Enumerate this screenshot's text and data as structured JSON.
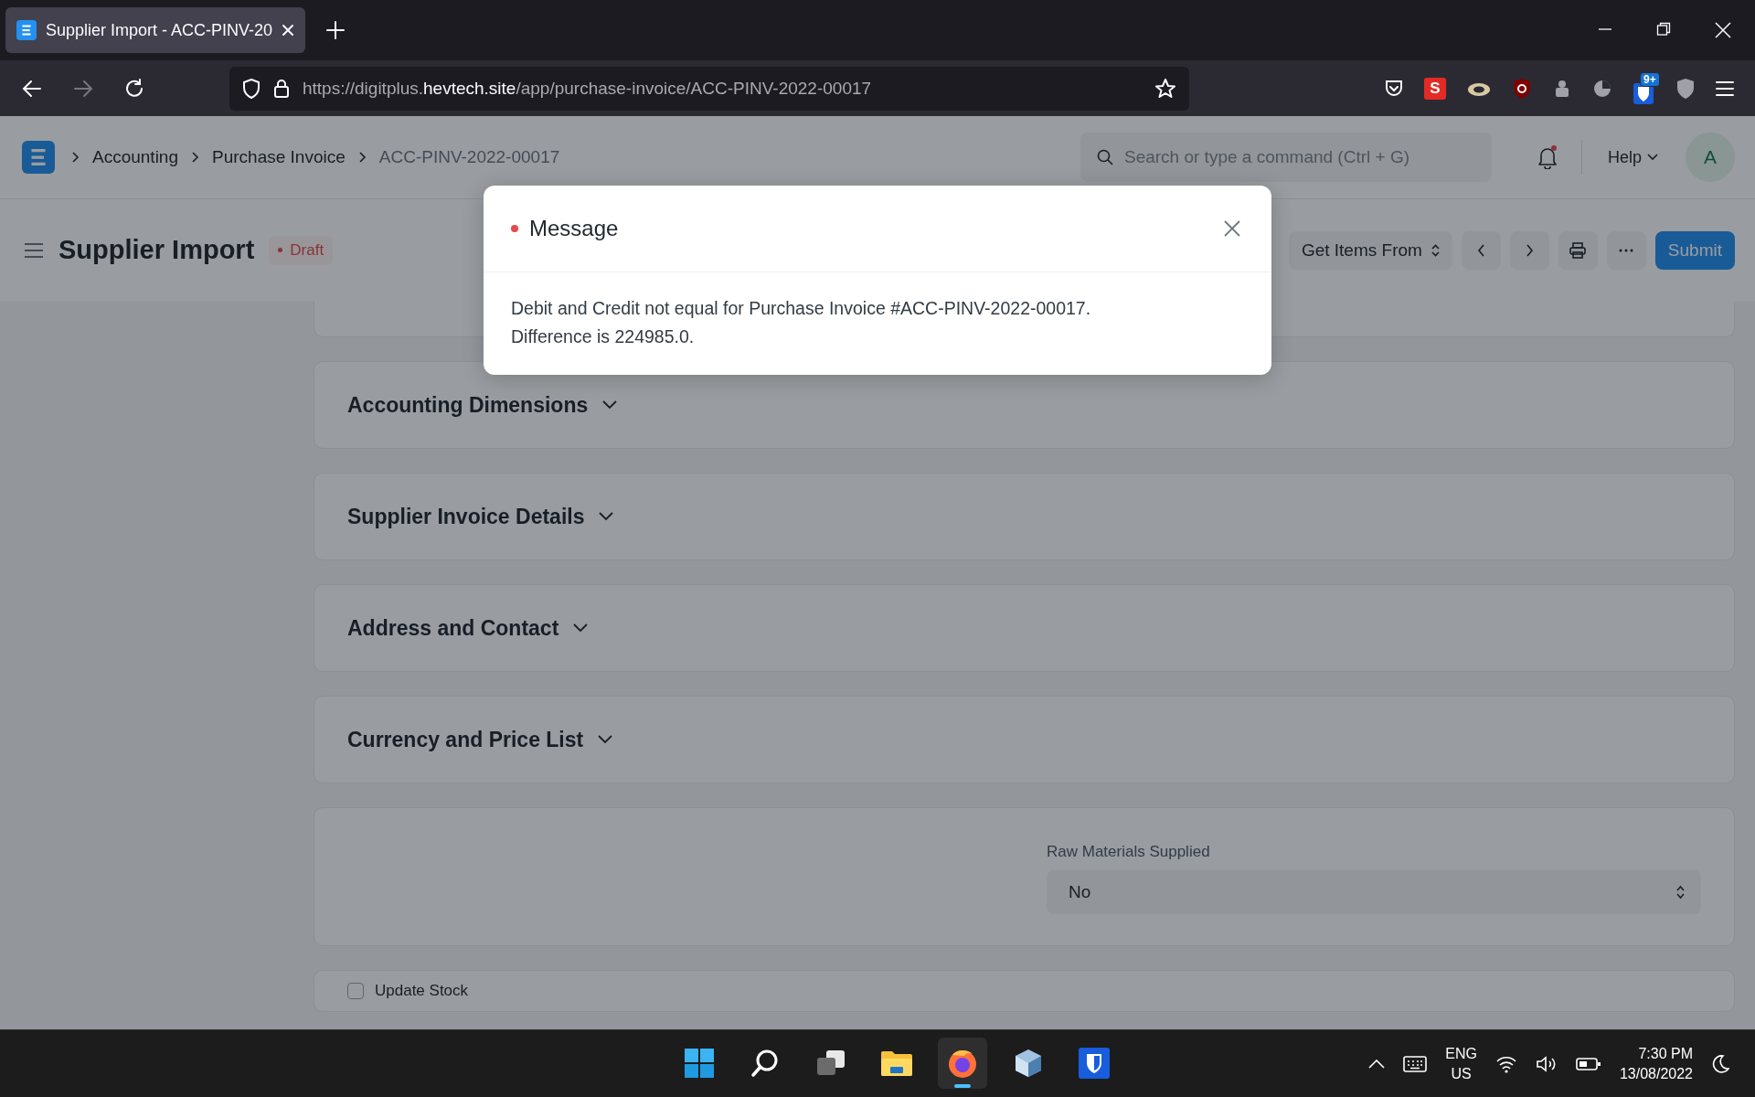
{
  "browser": {
    "tab": {
      "title": "Supplier Import - ACC-PINV-20"
    },
    "url": {
      "prefix": "https://digitplus.",
      "host": "hevtech.site",
      "path": "/app/purchase-invoice/ACC-PINV-2022-00017"
    },
    "extension_letter": "S",
    "extension_badge": "9+"
  },
  "navbar": {
    "breadcrumbs": [
      "Accounting",
      "Purchase Invoice",
      "ACC-PINV-2022-00017"
    ],
    "search": {
      "placeholder": "Search or type a command (Ctrl + G)"
    },
    "notification_unread": true,
    "help": "Help",
    "avatar": "A"
  },
  "page": {
    "title": "Supplier Import",
    "status": "Draft",
    "get_items": "Get Items From",
    "submit": "Submit"
  },
  "sections": [
    {
      "kind": "partial"
    },
    {
      "kind": "collapsed",
      "title": "Accounting Dimensions"
    },
    {
      "kind": "collapsed",
      "title": "Supplier Invoice Details"
    },
    {
      "kind": "collapsed",
      "title": "Address and Contact"
    },
    {
      "kind": "collapsed",
      "title": "Currency and Price List"
    },
    {
      "kind": "select",
      "label": "Raw Materials Supplied",
      "value": "No"
    },
    {
      "kind": "checkbox",
      "label": "Update Stock",
      "checked": false
    }
  ],
  "modal": {
    "title": "Message",
    "lines": [
      "Debit and Credit not equal for Purchase Invoice #ACC-PINV-2022-00017.",
      "Difference is 224985.0."
    ]
  },
  "taskbar": {
    "language": "ENG",
    "region": "US",
    "time": "7:30 PM",
    "date": "13/08/2022"
  }
}
